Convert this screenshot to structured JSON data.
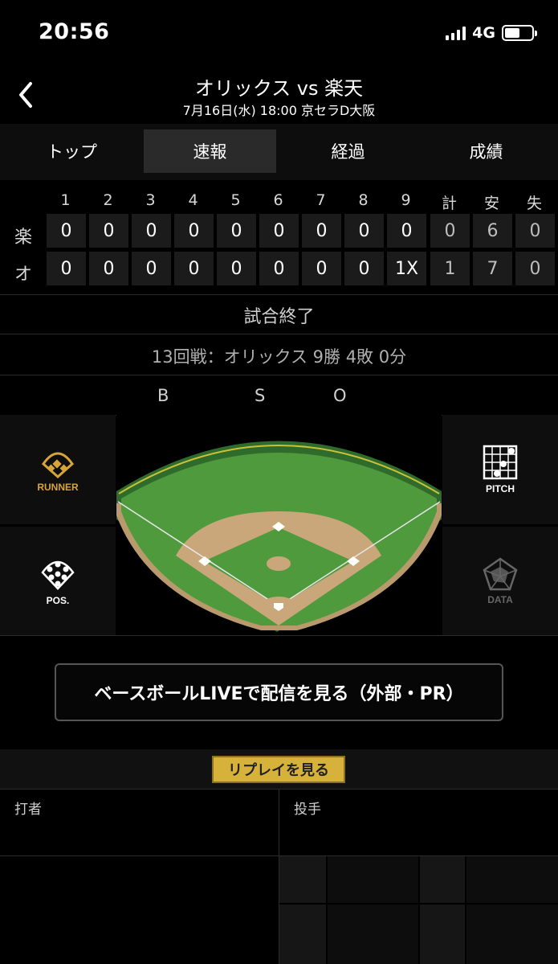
{
  "status_bar": {
    "time": "20:56",
    "network": "4G",
    "battery_level": 0.55
  },
  "header": {
    "back_icon": "chevron-left-icon",
    "title": "オリックス vs 楽天",
    "subtitle": "7月16日(水) 18:00 京セラD大阪"
  },
  "tabs": [
    {
      "label": "トップ",
      "active": false
    },
    {
      "label": "速報",
      "active": true
    },
    {
      "label": "経過",
      "active": false
    },
    {
      "label": "成績",
      "active": false
    }
  ],
  "scoreboard": {
    "headers": [
      "1",
      "2",
      "3",
      "4",
      "5",
      "6",
      "7",
      "8",
      "9",
      "計",
      "安",
      "失"
    ],
    "rows": [
      {
        "team": "楽",
        "cells": [
          "0",
          "0",
          "0",
          "0",
          "0",
          "0",
          "0",
          "0",
          "0",
          "0",
          "6",
          "0"
        ]
      },
      {
        "team": "オ",
        "cells": [
          "0",
          "0",
          "0",
          "0",
          "0",
          "0",
          "0",
          "0",
          "1X",
          "1",
          "7",
          "0"
        ]
      }
    ]
  },
  "game_status": "試合終了",
  "series_record": "13回戦：オリックス 9勝 4敗 0分",
  "count_labels": {
    "balls": "B",
    "strikes": "S",
    "outs": "O"
  },
  "field_buttons": {
    "runner": {
      "label": "RUNNER",
      "icon": "runner-diamond-icon",
      "color": "#d7a43a"
    },
    "pitch": {
      "label": "PITCH",
      "icon": "pitch-grid-icon"
    },
    "pos": {
      "label": "POS.",
      "icon": "positions-icon"
    },
    "data": {
      "label": "DATA",
      "icon": "radar-chart-icon",
      "disabled": true
    }
  },
  "live_button": "ベースボールLIVEで配信を見る（外部・PR）",
  "replay_button": "リプレイを見る",
  "batter_label": "打者",
  "pitcher_label": "投手",
  "colors": {
    "accent_gold": "#d7b23a",
    "grass": "#4f9a3c",
    "dirt": "#c9a77a"
  }
}
